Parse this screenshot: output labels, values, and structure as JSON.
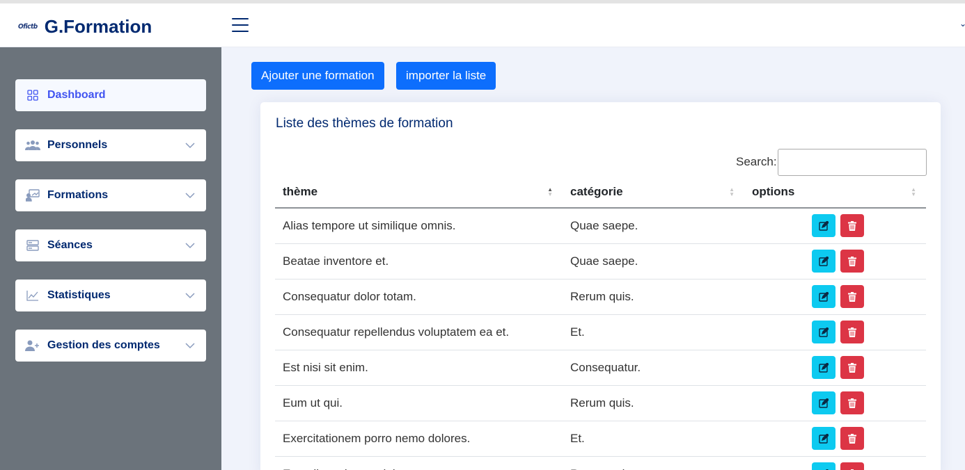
{
  "app": {
    "logo_mark": "Ofictb",
    "title": "G.Formation"
  },
  "sidebar": {
    "items": [
      {
        "label": "Dashboard",
        "icon": "grid-icon",
        "active": true
      },
      {
        "label": "Personnels",
        "icon": "people-icon"
      },
      {
        "label": "Formations",
        "icon": "presentation-icon"
      },
      {
        "label": "Séances",
        "icon": "server-icon"
      },
      {
        "label": "Statistiques",
        "icon": "graph-icon"
      },
      {
        "label": "Gestion des comptes",
        "icon": "person-plus-icon"
      }
    ]
  },
  "toolbar": {
    "add_label": "Ajouter une formation",
    "import_label": "importer la liste"
  },
  "card": {
    "title": "Liste des thèmes de formation",
    "search_label": "Search:",
    "columns": [
      "thème",
      "catégorie",
      "options"
    ],
    "rows": [
      {
        "theme": "Alias tempore ut similique omnis.",
        "categorie": "Quae saepe."
      },
      {
        "theme": "Beatae inventore et.",
        "categorie": "Quae saepe."
      },
      {
        "theme": "Consequatur dolor totam.",
        "categorie": "Rerum quis."
      },
      {
        "theme": "Consequatur repellendus voluptatem ea et.",
        "categorie": "Et."
      },
      {
        "theme": "Est nisi sit enim.",
        "categorie": "Consequatur."
      },
      {
        "theme": "Eum ut qui.",
        "categorie": "Rerum quis."
      },
      {
        "theme": "Exercitationem porro nemo dolores.",
        "categorie": "Et."
      },
      {
        "theme": "Expedita voluptas dolorem.",
        "categorie": "Rerum quis."
      }
    ]
  },
  "colors": {
    "primary": "#0d6efd",
    "edit": "#0dcaf0",
    "delete": "#dc3545",
    "sidebar": "#6b737b",
    "navy": "#012970"
  }
}
